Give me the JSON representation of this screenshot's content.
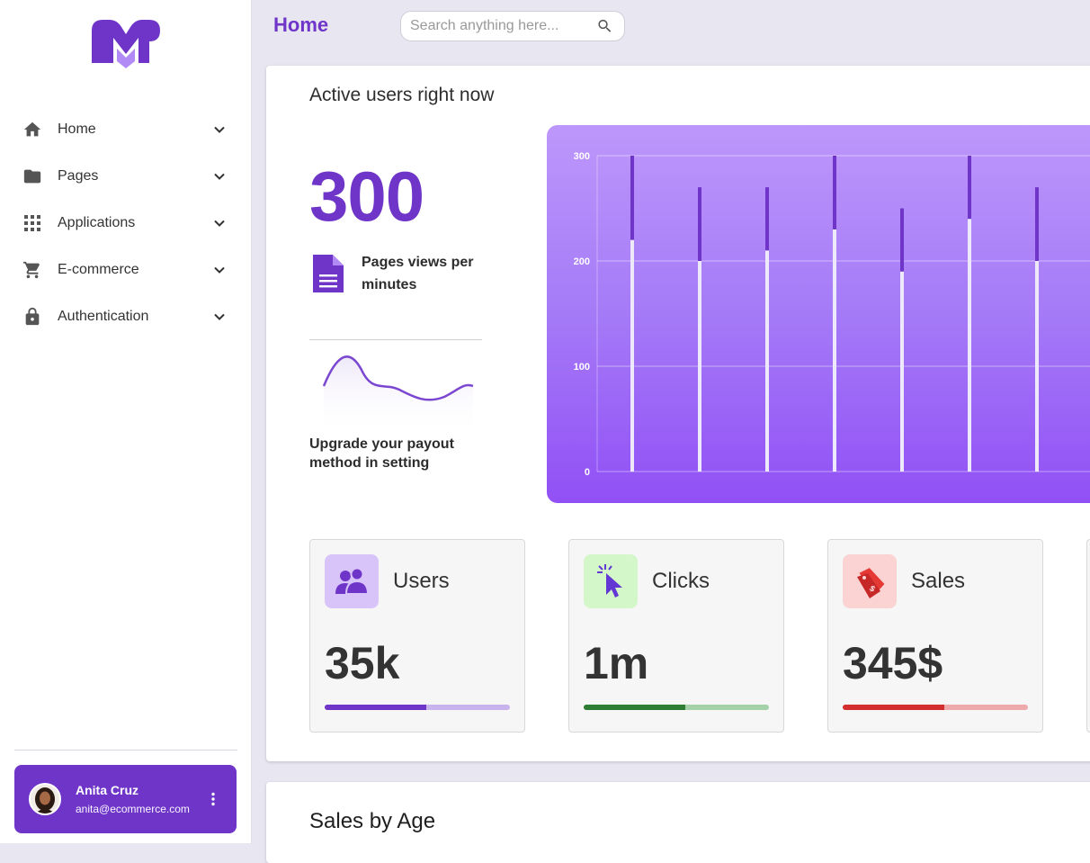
{
  "colors": {
    "brand": "#6f35c9",
    "users_accent": "#6f35c9",
    "clicks_accent": "#2e7d32",
    "sales_accent": "#d32f2f"
  },
  "sidebar": {
    "logo_icon": "m-logo-icon",
    "items": [
      {
        "label": "Home",
        "icon": "home-icon"
      },
      {
        "label": "Pages",
        "icon": "folder-icon"
      },
      {
        "label": "Applications",
        "icon": "grid-icon"
      },
      {
        "label": "E-commerce",
        "icon": "cart-icon"
      },
      {
        "label": "Authentication",
        "icon": "lock-icon"
      }
    ],
    "user": {
      "name": "Anita Cruz",
      "email": "anita@ecommerce.com"
    }
  },
  "header": {
    "title": "Home",
    "search_placeholder": "Search anything here..."
  },
  "main": {
    "card_title": "Active users right now",
    "big_number": "300",
    "pages_views_label": "Pages views per minutes",
    "payout_text": "Upgrade your payout method in setting",
    "stats": [
      {
        "label": "Users",
        "value": "35k",
        "icon": "users-icon",
        "progress": 0.55
      },
      {
        "label": "Clicks",
        "value": "1m",
        "icon": "cursor-click-icon",
        "progress": 0.55
      },
      {
        "label": "Sales",
        "value": "345$",
        "icon": "sale-tag-icon",
        "progress": 0.55
      }
    ]
  },
  "chart_data": {
    "type": "bar",
    "title": "",
    "ylim": [
      0,
      300
    ],
    "y_ticks": [
      "300",
      "200",
      "100",
      "0"
    ],
    "grid": true,
    "series": [
      {
        "values": [
          220,
          200,
          210,
          230,
          190,
          240,
          200
        ]
      },
      {
        "values": [
          300,
          270,
          270,
          300,
          250,
          300,
          270
        ]
      }
    ]
  },
  "second_card": {
    "title": "Sales by Age"
  }
}
